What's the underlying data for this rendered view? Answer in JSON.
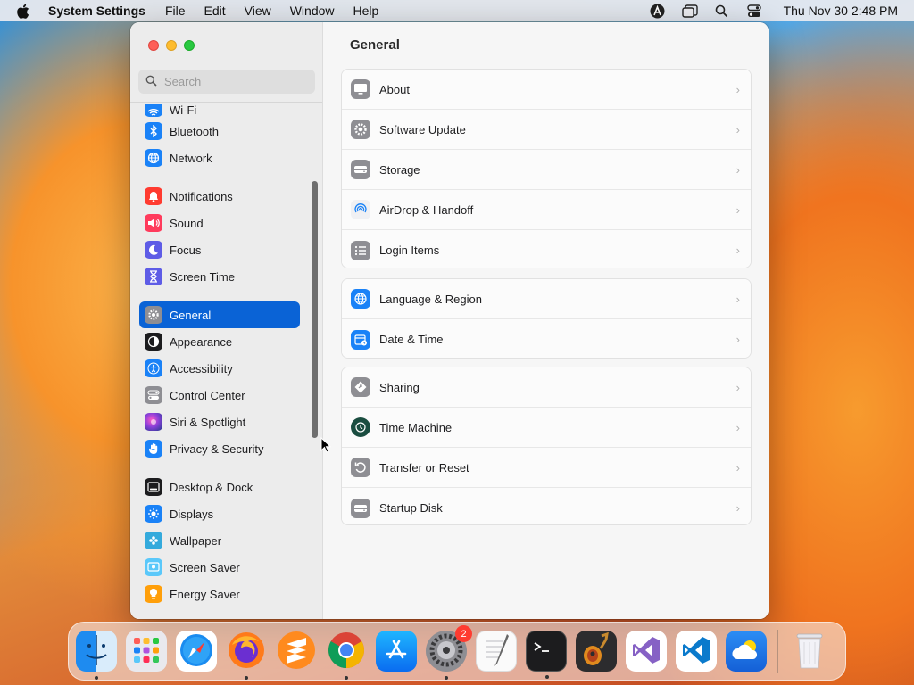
{
  "menubar": {
    "app_name": "System Settings",
    "items": [
      "File",
      "Edit",
      "View",
      "Window",
      "Help"
    ],
    "clock": "Thu Nov 30  2:48 PM"
  },
  "sidebar": {
    "search_placeholder": "Search",
    "items": [
      {
        "label": "Wi-Fi",
        "icon": "wifi-icon",
        "color": "#1a82f7"
      },
      {
        "label": "Bluetooth",
        "icon": "bluetooth-icon",
        "color": "#1a82f7"
      },
      {
        "label": "Network",
        "icon": "network-globe-icon",
        "color": "#1a82f7"
      },
      {
        "label": "Notifications",
        "icon": "bell-icon",
        "color": "#ff3b30"
      },
      {
        "label": "Sound",
        "icon": "speaker-icon",
        "color": "#ff3b5c"
      },
      {
        "label": "Focus",
        "icon": "moon-icon",
        "color": "#5e5ce6"
      },
      {
        "label": "Screen Time",
        "icon": "hourglass-icon",
        "color": "#5e5ce6"
      },
      {
        "label": "General",
        "icon": "gear-icon",
        "color": "#8e8e93"
      },
      {
        "label": "Appearance",
        "icon": "appearance-icon",
        "color": "#1c1c1e"
      },
      {
        "label": "Accessibility",
        "icon": "accessibility-icon",
        "color": "#1a82f7"
      },
      {
        "label": "Control Center",
        "icon": "control-center-icon",
        "color": "#8e8e93"
      },
      {
        "label": "Siri & Spotlight",
        "icon": "siri-icon",
        "color": "#8b3fd9"
      },
      {
        "label": "Privacy & Security",
        "icon": "hand-icon",
        "color": "#1a82f7"
      },
      {
        "label": "Desktop & Dock",
        "icon": "dock-icon",
        "color": "#1c1c1e"
      },
      {
        "label": "Displays",
        "icon": "sun-icon",
        "color": "#1a82f7"
      },
      {
        "label": "Wallpaper",
        "icon": "wallpaper-icon",
        "color": "#34aadc"
      },
      {
        "label": "Screen Saver",
        "icon": "screen-saver-icon",
        "color": "#5ac8fa"
      },
      {
        "label": "Energy Saver",
        "icon": "battery-icon",
        "color": "#ff9f0a"
      }
    ],
    "active": "General"
  },
  "content": {
    "title": "General",
    "groups": [
      [
        {
          "label": "About",
          "icon": "display-icon"
        },
        {
          "label": "Software Update",
          "icon": "gear-badge-icon"
        },
        {
          "label": "Storage",
          "icon": "disk-icon"
        },
        {
          "label": "AirDrop & Handoff",
          "icon": "airdrop-icon"
        },
        {
          "label": "Login Items",
          "icon": "list-icon"
        }
      ],
      [
        {
          "label": "Language & Region",
          "icon": "globe-icon"
        },
        {
          "label": "Date & Time",
          "icon": "calendar-clock-icon"
        }
      ],
      [
        {
          "label": "Sharing",
          "icon": "sharing-icon"
        },
        {
          "label": "Time Machine",
          "icon": "time-machine-icon"
        },
        {
          "label": "Transfer or Reset",
          "icon": "reset-icon"
        },
        {
          "label": "Startup Disk",
          "icon": "startup-disk-icon"
        }
      ]
    ]
  },
  "dock": {
    "apps": [
      {
        "name": "Finder",
        "icon": "finder-icon",
        "running": true
      },
      {
        "name": "Launchpad",
        "icon": "launchpad-icon",
        "running": false
      },
      {
        "name": "Safari",
        "icon": "safari-icon",
        "running": false
      },
      {
        "name": "Firefox",
        "icon": "firefox-icon",
        "running": true
      },
      {
        "name": "Sublime Text",
        "icon": "sublime-icon",
        "running": false
      },
      {
        "name": "Chrome",
        "icon": "chrome-icon",
        "running": true
      },
      {
        "name": "App Store",
        "icon": "app-store-icon",
        "running": false
      },
      {
        "name": "System Settings",
        "icon": "system-settings-icon",
        "running": true,
        "badge": "2"
      },
      {
        "name": "TextEdit",
        "icon": "textedit-icon",
        "running": false
      },
      {
        "name": "Terminal",
        "icon": "terminal-icon",
        "running": true
      },
      {
        "name": "GarageBand",
        "icon": "garageband-icon",
        "running": false
      },
      {
        "name": "Visual Studio",
        "icon": "visual-studio-icon",
        "running": false
      },
      {
        "name": "VS Code",
        "icon": "vscode-icon",
        "running": false
      },
      {
        "name": "Weather",
        "icon": "weather-icon",
        "running": false
      },
      {
        "name": "Trash",
        "icon": "trash-icon",
        "running": false
      }
    ]
  }
}
